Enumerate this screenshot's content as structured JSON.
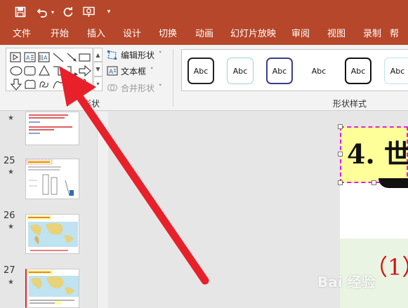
{
  "quick_access": {
    "save_icon": "save-icon",
    "undo_icon": "undo-icon",
    "undo_dropdown_icon": "chevron-down-icon",
    "redo_icon": "redo-icon",
    "present_icon": "present-from-start-icon",
    "customize_icon": "customize-toolbar-icon"
  },
  "tabs": [
    "文件",
    "开始",
    "插入",
    "设计",
    "切换",
    "动画",
    "幻灯片放映",
    "审阅",
    "视图",
    "录制",
    "帮"
  ],
  "ribbon": {
    "insert_shapes_group": {
      "label": "形状",
      "shapes": [
        "text-box-icon",
        "vertical-text-box-icon",
        "line-icon",
        "arrow-line-icon",
        "rectangle-icon",
        "oval-icon",
        "rounded-rectangle-icon",
        "triangle-icon",
        "elbow-connector-icon",
        "elbow-arrow-connector-icon",
        "right-arrow-icon",
        "down-arrow-icon",
        "freeform-icon",
        "scribble-icon",
        "curve-icon",
        "brace-icon"
      ],
      "edit_shape_label": "编辑形状",
      "text_box_label": "文本框",
      "merge_shapes_label": "合并形状"
    },
    "shape_styles_group": {
      "label": "形状样式",
      "styles": [
        "Abc",
        "Abc",
        "Abc",
        "Abc",
        "Abc",
        "Abc"
      ]
    }
  },
  "thumbnails": [
    {
      "number": "",
      "starred": true
    },
    {
      "number": "25",
      "starred": true
    },
    {
      "number": "26",
      "starred": true
    },
    {
      "number": "27",
      "starred": true
    }
  ],
  "star_glyph": "★",
  "slide": {
    "title_text": "4. 世",
    "body_text": "（1）"
  },
  "watermark": "Bai 经验",
  "colors": {
    "accent": "#b7472a",
    "arrow": "#e8202a",
    "title_fill": "#ffff99",
    "selection": "#e020e0"
  }
}
